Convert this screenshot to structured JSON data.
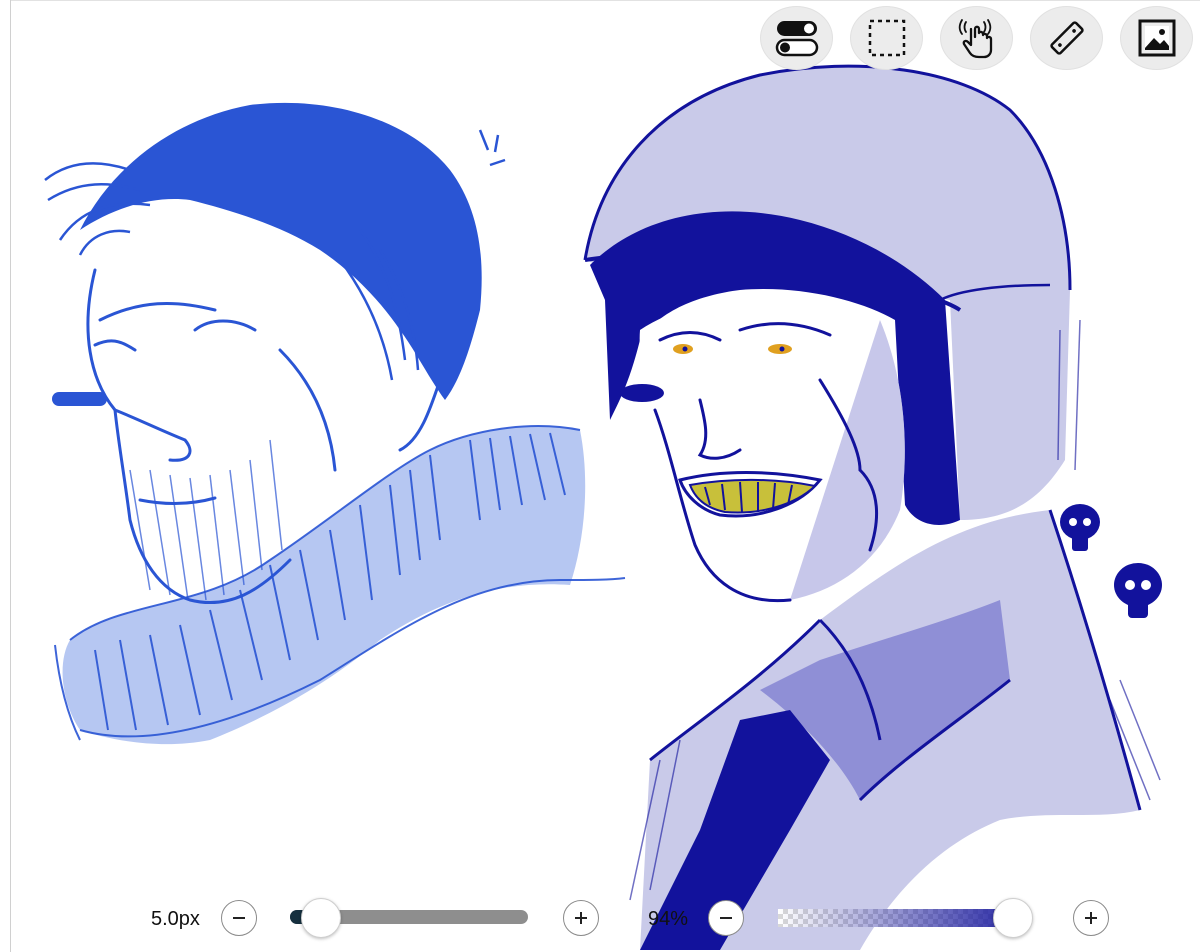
{
  "toolbar": {
    "tools": [
      {
        "name": "toggle-icon"
      },
      {
        "name": "selection-icon"
      },
      {
        "name": "touch-hand-icon"
      },
      {
        "name": "ruler-icon"
      },
      {
        "name": "image-icon"
      }
    ]
  },
  "brush": {
    "size_label": "5.0px",
    "size_fraction": 0.13,
    "opacity_label": "94%",
    "opacity_fraction": 0.94,
    "color": "#1f1fa0"
  },
  "colors": {
    "sketch_left": "#2a55d4",
    "sketch_left_light": "#a9bdf0",
    "sketch_right_dark": "#12129c",
    "sketch_right_mid": "#8f8fd6",
    "sketch_right_light": "#c9cae9",
    "teeth": "#c8c03a",
    "eyes": "#e0a020"
  }
}
